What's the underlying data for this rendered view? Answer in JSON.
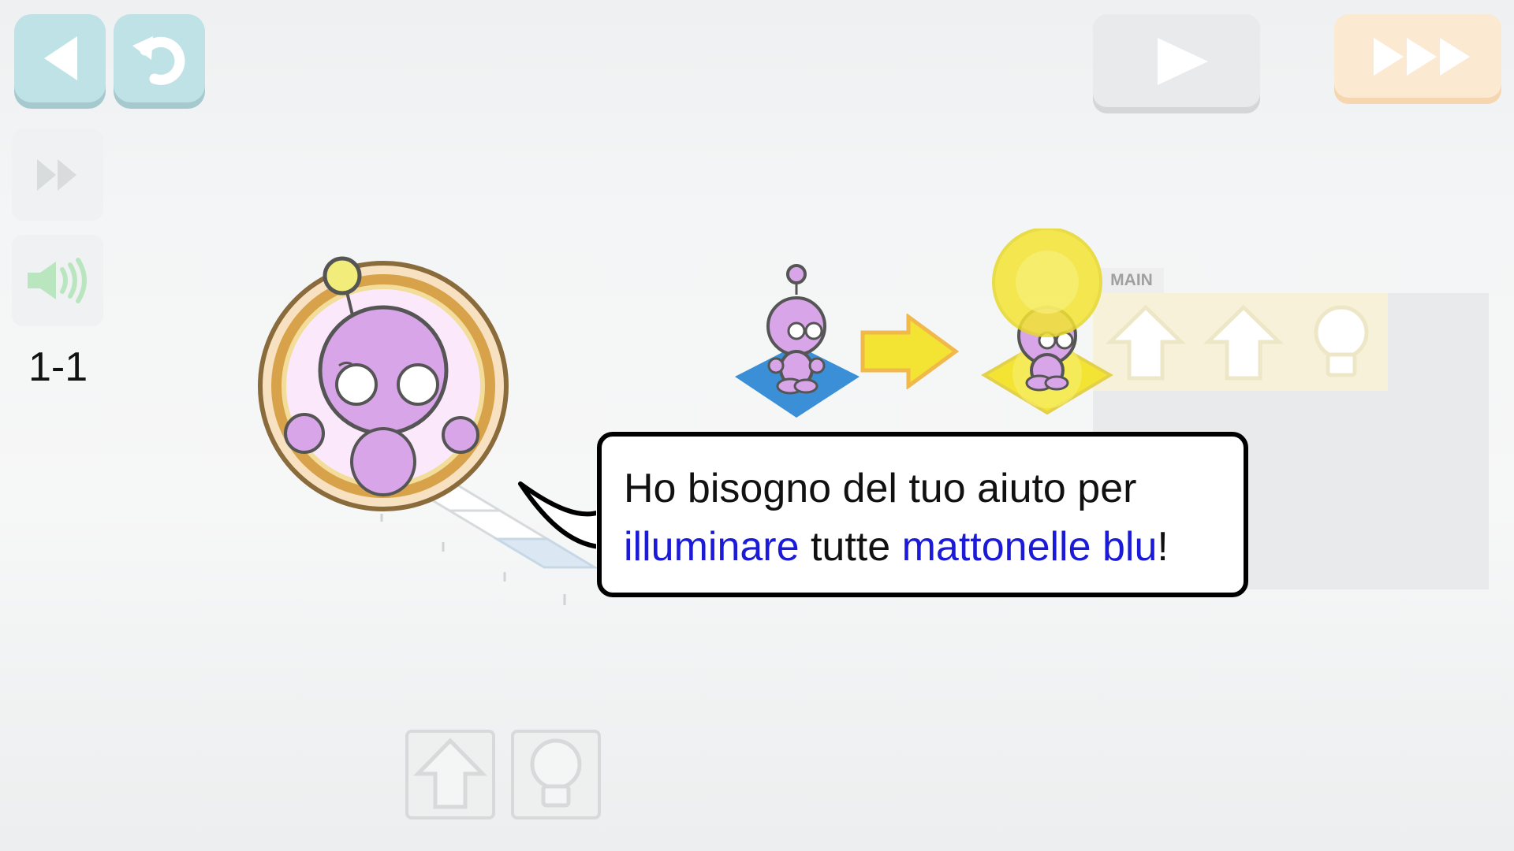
{
  "toolbar": {
    "back_icon": "back-arrow-icon",
    "reset_icon": "undo-icon",
    "skip_icon": "double-chevron-right-icon",
    "sound_icon": "speaker-icon",
    "play_icon": "play-icon",
    "fast_icon": "fast-forward-icon"
  },
  "level": {
    "label": "1-1"
  },
  "program": {
    "main_label": "MAIN",
    "slots": [
      "forward-arrow-icon",
      "forward-arrow-icon",
      "light-bulb-icon"
    ]
  },
  "dialog": {
    "line1": "Ho bisogno del tuo aiuto per",
    "line2_part1": "illuminare",
    "line2_part2": " tutte ",
    "line2_part3": "mattonelle blu",
    "line2_part4": "!"
  },
  "palette": {
    "commands": [
      "forward-arrow-icon",
      "light-bulb-icon"
    ]
  },
  "colors": {
    "teal_button": "#bfe2e6",
    "orange_button": "#fbe9d2",
    "highlight_text": "#1a1ad8",
    "robot_purple": "#d8a6e8",
    "tile_blue": "#3a8fd6",
    "tile_yellow": "#f3e433"
  }
}
